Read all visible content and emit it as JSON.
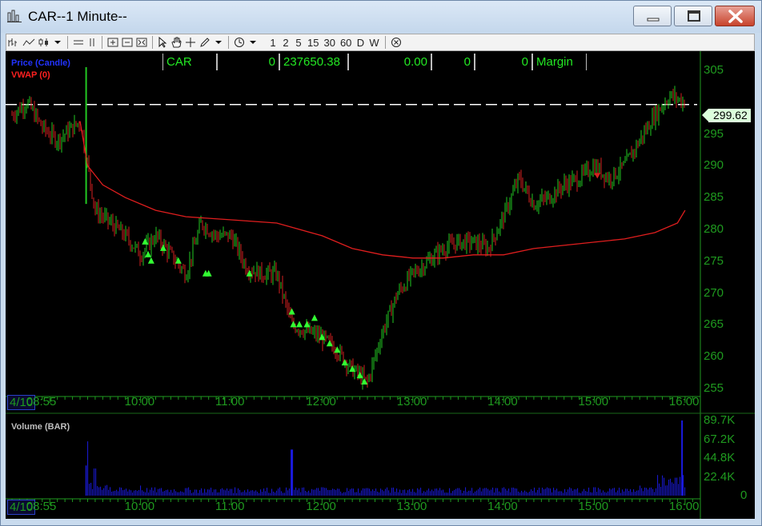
{
  "window": {
    "title": "CAR--1 Minute--",
    "minimize_icon": "minimize-icon",
    "maximize_icon": "maximize-icon",
    "close_icon": "close-icon"
  },
  "toolbar": {
    "interval_labels": [
      "1",
      "2",
      "5",
      "15",
      "30",
      "60",
      "D",
      "W"
    ],
    "icons": [
      "bars-icon",
      "line-icon",
      "candle-icon",
      "dropdown-icon",
      "hline-icon",
      "vline-icon",
      "zoom-in-icon",
      "zoom-out-icon",
      "fit-icon",
      "pointer-icon",
      "hand-icon",
      "crosshair-icon",
      "pencil-icon",
      "dropdown-icon",
      "clock-icon",
      "dropdown-icon",
      "close-circle-icon"
    ]
  },
  "info_bar": {
    "symbol": "CAR",
    "qty": "0",
    "value": "237650.38",
    "pnl": "0.00",
    "field5": "0",
    "field6": "0",
    "account": "Margin"
  },
  "price_pane": {
    "legend_price": "Price (Candle)",
    "legend_vwap": "VWAP (0)",
    "last_price": "299.62",
    "y_ticks": [
      "305",
      "295",
      "290",
      "285",
      "280",
      "275",
      "270",
      "265",
      "260",
      "255"
    ]
  },
  "volume_pane": {
    "title": "Volume (BAR)",
    "y_ticks": [
      "89.7K",
      "67.2K",
      "44.8K",
      "22.4K",
      "0"
    ]
  },
  "x_axis": {
    "date": "4/10",
    "ticks": [
      "08:55",
      "10:00",
      "11:00",
      "12:00",
      "13:00",
      "14:00",
      "15:00",
      "16:00"
    ]
  },
  "colors": {
    "up": "#22c822",
    "down": "#d42020",
    "vwap": "#e01e1e",
    "axis_green": "#1f9a1f",
    "volume": "#1a1ae0",
    "marker": "#33ff33"
  },
  "chart_data": {
    "type": "line",
    "title": "",
    "ylim": [
      255,
      306
    ],
    "x_unit": "time (4/10)",
    "series": [
      {
        "name": "Price (Candle)",
        "x": [
          "08:35",
          "08:45",
          "08:55",
          "09:05",
          "09:20",
          "09:30",
          "09:40",
          "09:50",
          "10:00",
          "10:10",
          "10:20",
          "10:30",
          "10:40",
          "10:50",
          "11:00",
          "11:10",
          "11:20",
          "11:30",
          "11:40",
          "11:50",
          "12:00",
          "12:10",
          "12:20",
          "12:30",
          "12:40",
          "12:50",
          "13:00",
          "13:10",
          "13:20",
          "13:30",
          "13:40",
          "13:50",
          "14:00",
          "14:10",
          "14:20",
          "14:30",
          "14:40",
          "14:50",
          "15:00",
          "15:10",
          "15:20",
          "15:30",
          "15:40",
          "15:50",
          "16:00"
        ],
        "values": [
          298,
          300,
          296,
          294,
          297,
          283,
          281,
          279,
          276,
          279,
          276,
          273,
          281,
          279,
          279,
          274,
          273,
          273,
          265,
          264,
          263,
          261,
          258,
          256,
          264,
          270,
          273,
          275,
          277,
          278,
          278,
          277,
          282,
          288,
          284,
          285,
          287,
          288,
          290,
          288,
          290,
          294,
          298,
          301,
          300
        ]
      },
      {
        "name": "VWAP (0)",
        "x": [
          "09:20",
          "09:25",
          "09:35",
          "09:50",
          "10:10",
          "10:30",
          "11:00",
          "11:30",
          "12:00",
          "12:20",
          "12:40",
          "13:00",
          "13:20",
          "13:40",
          "14:00",
          "14:20",
          "14:40",
          "15:00",
          "15:20",
          "15:40",
          "15:55",
          "16:00"
        ],
        "values": [
          297,
          290,
          287,
          285,
          283,
          282,
          281.5,
          281,
          279,
          277,
          276,
          275.5,
          275.5,
          276,
          276,
          277,
          277.5,
          278,
          278.5,
          279.5,
          281,
          283
        ]
      }
    ],
    "volume": {
      "name": "Volume (BAR)",
      "ylim": [
        0,
        89700
      ],
      "x": [
        "09:00",
        "09:20",
        "09:25",
        "09:30",
        "10:00",
        "10:30",
        "11:00",
        "11:30",
        "11:40",
        "12:00",
        "12:30",
        "13:00",
        "13:30",
        "14:00",
        "14:30",
        "15:00",
        "15:30",
        "15:45",
        "15:55",
        "16:00"
      ],
      "values": [
        1500,
        2000,
        36000,
        18000,
        12000,
        9000,
        8000,
        6000,
        55000,
        10000,
        9000,
        8000,
        9000,
        10000,
        9000,
        10000,
        12000,
        20000,
        89700,
        8000
      ]
    }
  }
}
